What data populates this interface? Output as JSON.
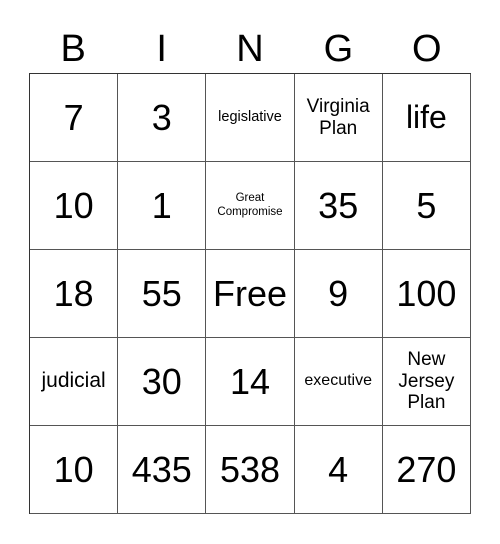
{
  "header": [
    "B",
    "I",
    "N",
    "G",
    "O"
  ],
  "rows": [
    [
      "7",
      "3",
      "legislative",
      "Virginia Plan",
      "life"
    ],
    [
      "10",
      "1",
      "Great Compromise",
      "35",
      "5"
    ],
    [
      "18",
      "55",
      "Free",
      "9",
      "100"
    ],
    [
      "judicial",
      "30",
      "14",
      "executive",
      "New Jersey Plan"
    ],
    [
      "10",
      "435",
      "538",
      "4",
      "270"
    ]
  ]
}
